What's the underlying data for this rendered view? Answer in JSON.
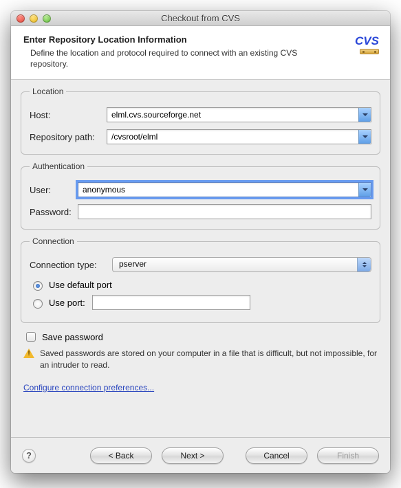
{
  "window": {
    "title": "Checkout from CVS"
  },
  "banner": {
    "heading": "Enter Repository Location Information",
    "subtext": "Define the location and protocol required to connect with an existing CVS repository.",
    "logo_text": "CVS"
  },
  "location": {
    "legend": "Location",
    "host_label": "Host:",
    "host_value": "elml.cvs.sourceforge.net",
    "repo_label": "Repository path:",
    "repo_value": "/cvsroot/elml"
  },
  "auth": {
    "legend": "Authentication",
    "user_label": "User:",
    "user_value": "anonymous",
    "pass_label": "Password:",
    "pass_value": ""
  },
  "conn": {
    "legend": "Connection",
    "type_label": "Connection type:",
    "type_value": "pserver",
    "default_port_label": "Use default port",
    "use_port_label": "Use port:",
    "port_value": ""
  },
  "save": {
    "checkbox_label": "Save password",
    "warning": "Saved passwords are stored on your computer in a file that is difficult, but not impossible, for an intruder to read."
  },
  "link": {
    "configure": "Configure connection preferences..."
  },
  "buttons": {
    "back": "< Back",
    "next": "Next >",
    "cancel": "Cancel",
    "finish": "Finish"
  }
}
